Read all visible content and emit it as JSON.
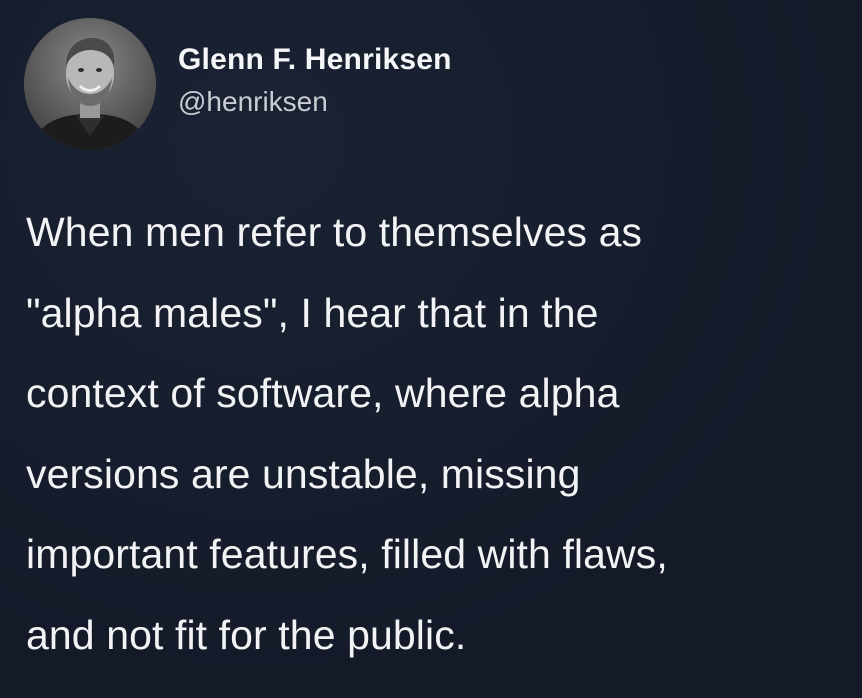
{
  "author": {
    "display_name": "Glenn F. Henriksen",
    "handle": "@henriksen",
    "avatar_icon": "profile-photo"
  },
  "tweet": {
    "lines": [
      "When men refer to themselves as",
      "\"alpha males\", I hear that in the",
      "context of software, where alpha",
      "versions are unstable, missing",
      "important features, filled with flaws,",
      "and not fit for the public."
    ]
  },
  "colors": {
    "background": "#151c2b",
    "text": "#f2f3f5",
    "handle": "#c9ccd3"
  }
}
